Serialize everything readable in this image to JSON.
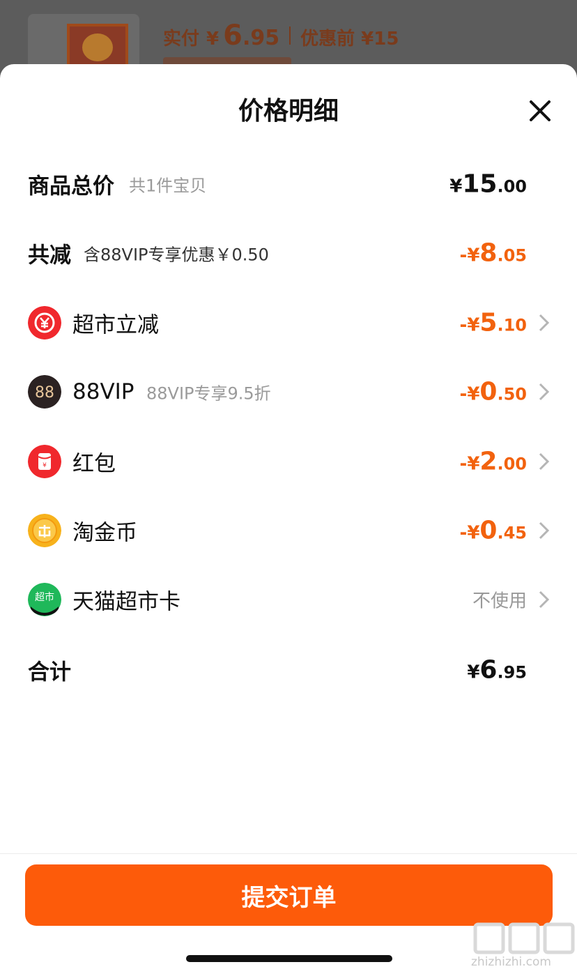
{
  "background": {
    "paid_label": "实付",
    "currency": "¥",
    "paid_int": "6",
    "paid_dec": ".95",
    "before_text": "优惠前 ¥15"
  },
  "sheet": {
    "title": "价格明细",
    "rows": {
      "total": {
        "label": "商品总价",
        "sub": "共1件宝贝",
        "cur": "¥",
        "int": "15",
        "dec": ".00"
      },
      "reduce": {
        "label": "共减",
        "sub": "含88VIP专享优惠￥0.50",
        "cur": "-¥",
        "int": "8",
        "dec": ".05"
      },
      "market": {
        "label": "超市立减",
        "cur": "-¥",
        "int": "5",
        "dec": ".10",
        "icon": "yuan-coin-icon"
      },
      "vip": {
        "label": "88VIP",
        "sub": "88VIP专享9.5折",
        "cur": "-¥",
        "int": "0",
        "dec": ".50",
        "icon": "88vip-icon",
        "icon_text": "88"
      },
      "redpack": {
        "label": "红包",
        "cur": "-¥",
        "int": "2",
        "dec": ".00",
        "icon": "red-envelope-icon"
      },
      "coin": {
        "label": "淘金币",
        "cur": "-¥",
        "int": "0",
        "dec": ".45",
        "icon": "gold-coin-icon"
      },
      "card": {
        "label": "天猫超市卡",
        "value": "不使用",
        "icon": "tmall-market-card-icon",
        "icon_text": "超市"
      },
      "sum": {
        "label": "合计",
        "cur": "¥",
        "int": "6",
        "dec": ".95"
      }
    },
    "submit_label": "提交订单"
  },
  "watermark": {
    "text": "zhizhizhi.com"
  },
  "colors": {
    "accent": "#fd5b0a",
    "discount": "#f2620e",
    "text": "#111111",
    "muted": "#9a9a9a"
  }
}
